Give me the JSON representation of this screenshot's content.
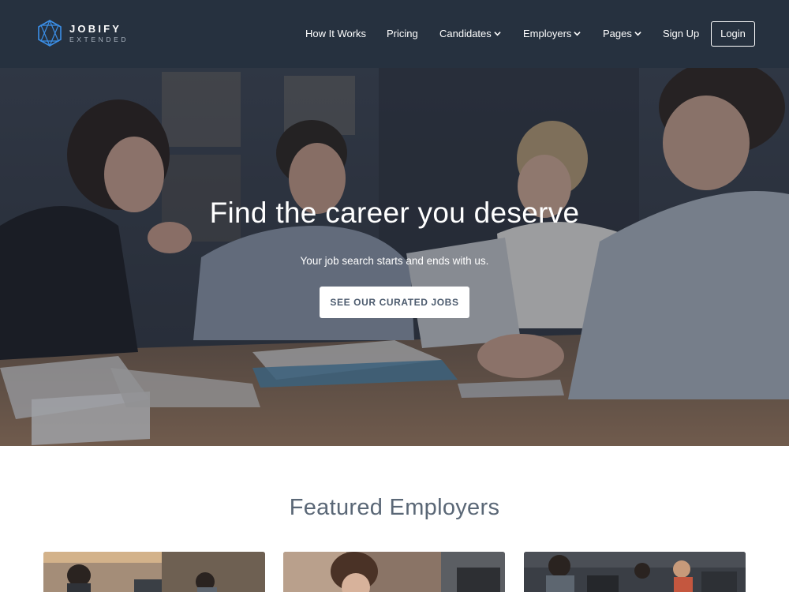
{
  "brand": {
    "name": "JOBIFY",
    "tagline": "EXTENDED",
    "logo_icon": "hexagon-star-icon",
    "accent": "#3b8fe8"
  },
  "nav": {
    "items": [
      {
        "label": "How It Works",
        "has_dropdown": false
      },
      {
        "label": "Pricing",
        "has_dropdown": false
      },
      {
        "label": "Candidates",
        "has_dropdown": true
      },
      {
        "label": "Employers",
        "has_dropdown": true
      },
      {
        "label": "Pages",
        "has_dropdown": true
      },
      {
        "label": "Sign Up",
        "has_dropdown": false
      }
    ],
    "login_label": "Login"
  },
  "hero": {
    "title": "Find the career you deserve",
    "subtitle": "Your job search starts and ends with us.",
    "cta_label": "SEE OUR CURATED JOBS"
  },
  "featured": {
    "title": "Featured Employers",
    "cards": [
      {
        "image": "office-team-photo"
      },
      {
        "image": "office-woman-photo"
      },
      {
        "image": "office-desks-photo"
      }
    ]
  },
  "colors": {
    "navbar": "#26313f",
    "heading": "#5a6776",
    "cta_text": "#4c5b6e"
  }
}
